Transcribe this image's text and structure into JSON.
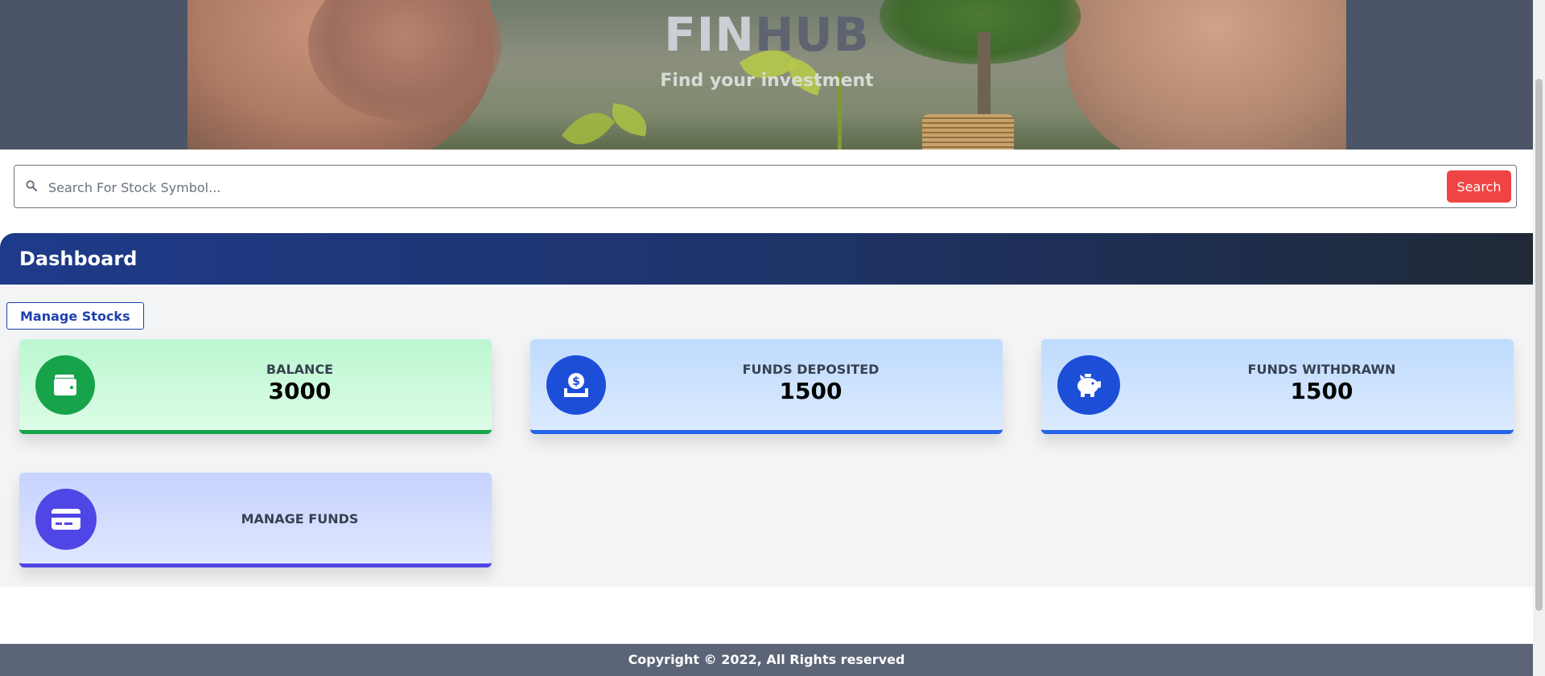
{
  "hero": {
    "brand_part1": "FIN",
    "brand_part2": "HUB",
    "tagline": "Find your investment"
  },
  "search": {
    "placeholder": "Search For Stock Symbol...",
    "value": "",
    "button_label": "Search"
  },
  "dashboard": {
    "title": "Dashboard",
    "manage_stocks_label": "Manage Stocks",
    "cards": [
      {
        "label": "BALANCE",
        "value": "3000",
        "icon": "wallet-icon",
        "accent": "#16a34a"
      },
      {
        "label": "FUNDS DEPOSITED",
        "value": "1500",
        "icon": "dollar-deposit-icon",
        "accent": "#2563eb"
      },
      {
        "label": "FUNDS WITHDRAWN",
        "value": "1500",
        "icon": "piggy-bank-icon",
        "accent": "#2563eb"
      },
      {
        "label": "MANAGE FUNDS",
        "icon": "credit-card-icon",
        "accent": "#4f46e5"
      }
    ]
  },
  "footer": {
    "copyright": "Copyright © 2022, All Rights reserved"
  },
  "colors": {
    "search_button": "#ef4444",
    "header_gradient_start": "#1e3a8a",
    "header_gradient_end": "#1f2937",
    "footer": "#5b6577"
  }
}
